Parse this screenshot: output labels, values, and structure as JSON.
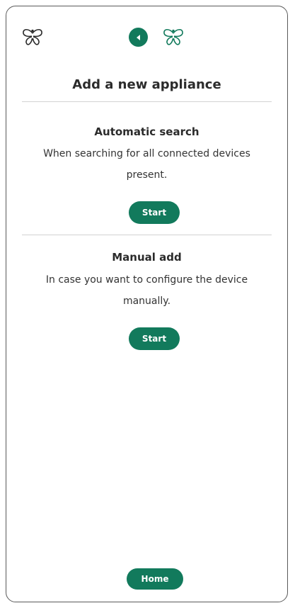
{
  "header": {
    "title": "Add a new appliance"
  },
  "sections": [
    {
      "title": "Automatic search",
      "description": "When searching for all connected devices present.",
      "button_label": "Start"
    },
    {
      "title": "Manual add",
      "description": "In case you want to configure the device manually.",
      "button_label": "Start"
    }
  ],
  "footer": {
    "home_label": "Home"
  },
  "colors": {
    "accent": "#127a5c",
    "text": "#2b2b2b",
    "divider": "#d2d2d2"
  },
  "icons": {
    "logo": "butterfly-logo-icon",
    "back": "chevron-left-icon"
  }
}
